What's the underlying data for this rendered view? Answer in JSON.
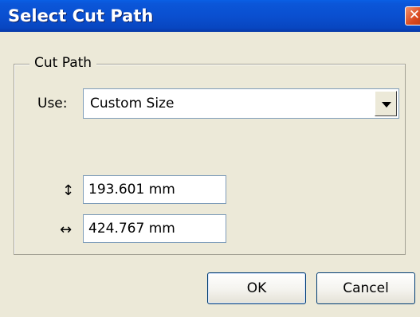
{
  "window": {
    "title": "Select Cut Path",
    "close_glyph": "✕"
  },
  "cut_path": {
    "group_label": "Cut Path",
    "use_label": "Use:",
    "use_value": "Custom Size",
    "height_icon": "vertical-arrows-icon",
    "height_glyph": "↕",
    "height_value": "193.601 mm",
    "width_icon": "horizontal-arrows-icon",
    "width_glyph": "↔",
    "width_value": "424.767 mm"
  },
  "buttons": {
    "ok_label": "OK",
    "cancel_label": "Cancel"
  },
  "colors": {
    "titlebar_blue": "#0a4fd0",
    "dialog_bg": "#ece9d8",
    "close_red": "#d9481f"
  }
}
